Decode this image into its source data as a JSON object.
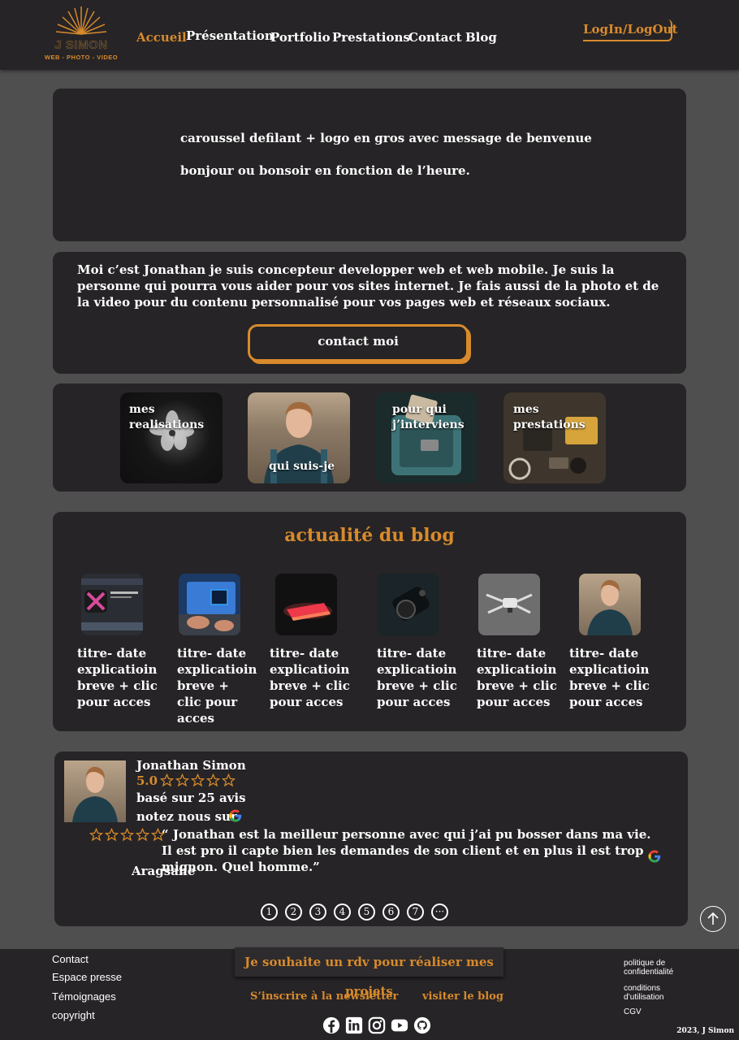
{
  "header": {
    "logo": {
      "name": "J SIMON",
      "tagline": "WEB - PHOTO - VIDEO"
    },
    "nav": [
      {
        "label": "Accueil",
        "active": true
      },
      {
        "label": "Présentation",
        "active": false
      },
      {
        "label": "Portfolio",
        "active": false
      },
      {
        "label": "Prestations",
        "active": false
      },
      {
        "label": "Contact",
        "active": false
      },
      {
        "label": "Blog",
        "active": false
      }
    ],
    "login_label": "LogIn/LogOut"
  },
  "hero": {
    "line1": "caroussel defilant + logo en gros avec message de benvenue",
    "line2": "bonjour ou bonsoir en fonction de l’heure."
  },
  "intro": {
    "text": "Moi c’est Jonathan je suis concepteur developper web et web mobile. Je suis la personne qui pourra vous aider pour vos sites internet. Je fais aussi de la photo et de la video pour du contenu personnalisé pour vos pages web et réseaux sociaux.",
    "contact_button": "contact moi"
  },
  "tiles": [
    {
      "label": "mes realisations"
    },
    {
      "label": "qui suis-je"
    },
    {
      "label": "pour qui j’interviens"
    },
    {
      "label": "mes prestations"
    }
  ],
  "blog": {
    "title": "actualité du blog",
    "posts": [
      {
        "text": "titre- date explicatioin breve + clic pour acces"
      },
      {
        "text": "titre- date explicatioin breve + clic pour acces"
      },
      {
        "text": "titre- date explicatioin breve + clic pour acces"
      },
      {
        "text": "titre- date explicatioin breve + clic pour acces"
      },
      {
        "text": "titre- date explicatioin breve + clic pour acces"
      },
      {
        "text": "titre- date explicatioin breve + clic pour acces"
      }
    ]
  },
  "review": {
    "name": "Jonathan Simon",
    "rating": "5.0",
    "based_on": "basé sur 25 avis",
    "rate_us": "notez nous sur",
    "quote": "“ Jonathan est la meilleur personne avec qui j’ai pu bosser dans ma vie. Il est pro il capte bien les demandes de son client et en plus il est trop mignon. Quel homme.”",
    "author": "Aragsane",
    "pages": [
      "1",
      "2",
      "3",
      "4",
      "5",
      "6",
      "7",
      "···"
    ]
  },
  "footer": {
    "left_links": [
      "Contact",
      "Espace presse",
      "Témoignages",
      "copyright"
    ],
    "rdv_button": "Je souhaite un rdv pour réaliser mes projets",
    "newsletter": "S’inscrire à la newsletter",
    "visit_blog": "visiter le blog",
    "right_links": [
      "politique de confidentialité",
      "conditions d’utilisation",
      "CGV"
    ],
    "socials": [
      "facebook-icon",
      "linkedin-icon",
      "instagram-icon",
      "youtube-icon",
      "github-icon"
    ],
    "copyright": "2023, J Simon"
  },
  "colors": {
    "accent": "#d88a2c",
    "card": "#262426",
    "background": "#4f4f4f"
  }
}
